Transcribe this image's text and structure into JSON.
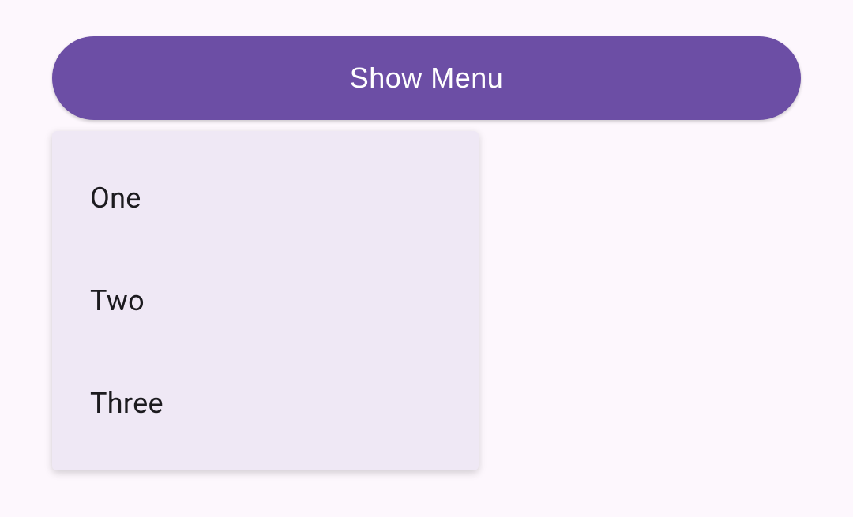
{
  "button": {
    "label": "Show Menu"
  },
  "menu": {
    "items": [
      {
        "label": "One"
      },
      {
        "label": "Two"
      },
      {
        "label": "Three"
      }
    ]
  }
}
